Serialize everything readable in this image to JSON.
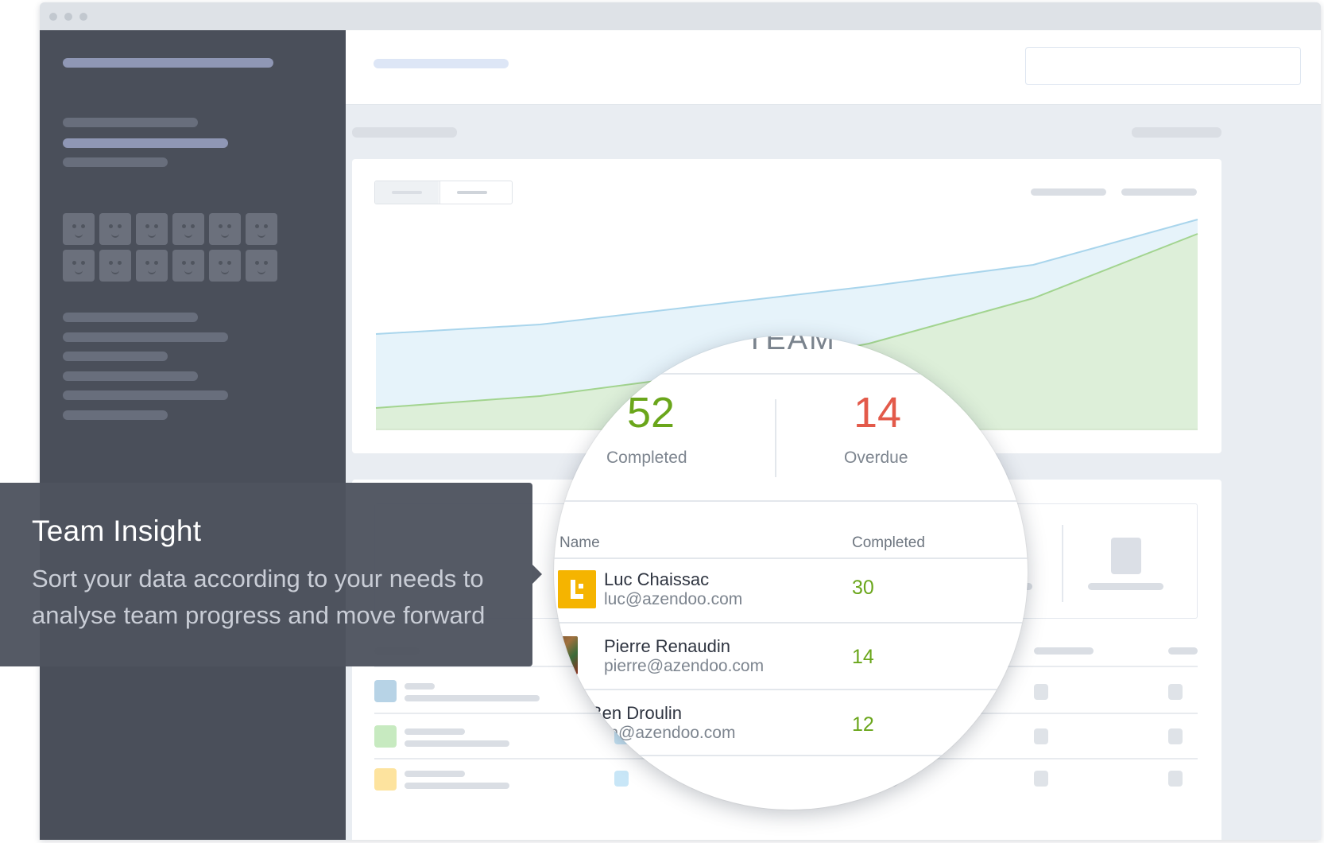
{
  "window": {
    "title_dots": 3
  },
  "tooltip": {
    "title": "Team Insight",
    "description": "Sort your data according to your needs to analyse team progress and move forward"
  },
  "magnifier": {
    "section_title": "TEAM",
    "stats": [
      {
        "value": "52",
        "label": "Completed",
        "color": "#6aa61b"
      },
      {
        "value": "14",
        "label": "Overdue",
        "color": "#e35a4a"
      }
    ],
    "table": {
      "columns": [
        "Name",
        "Completed"
      ],
      "rows": [
        {
          "name": "Luc Chaissac",
          "email": "luc@azendoo.com",
          "completed": "30",
          "avatar": "logo-l"
        },
        {
          "name": "Pierre Renaudin",
          "email": "pierre@azendoo.com",
          "completed": "14",
          "avatar": "photo"
        },
        {
          "name": "Ben Droulin",
          "email": "ben@azendoo.com",
          "completed": "12",
          "avatar": "photo"
        }
      ]
    }
  },
  "chart_data": {
    "type": "area",
    "x": [
      0,
      1,
      2,
      3,
      4,
      5
    ],
    "series": [
      {
        "values": [
          40,
          44,
          52,
          60,
          69,
          88
        ],
        "color": "#a9d5ec",
        "fill": "#e6f3fa"
      },
      {
        "values": [
          9,
          14,
          23,
          36,
          55,
          82
        ],
        "color": "#a2d48f",
        "fill": "#ddefd9"
      }
    ],
    "ylim": [
      0,
      100
    ],
    "grid": false,
    "legend": "none"
  },
  "colors": {
    "sidebar": "#4a4f5a",
    "accent_green": "#6aa61b",
    "accent_red": "#e35a4a"
  }
}
